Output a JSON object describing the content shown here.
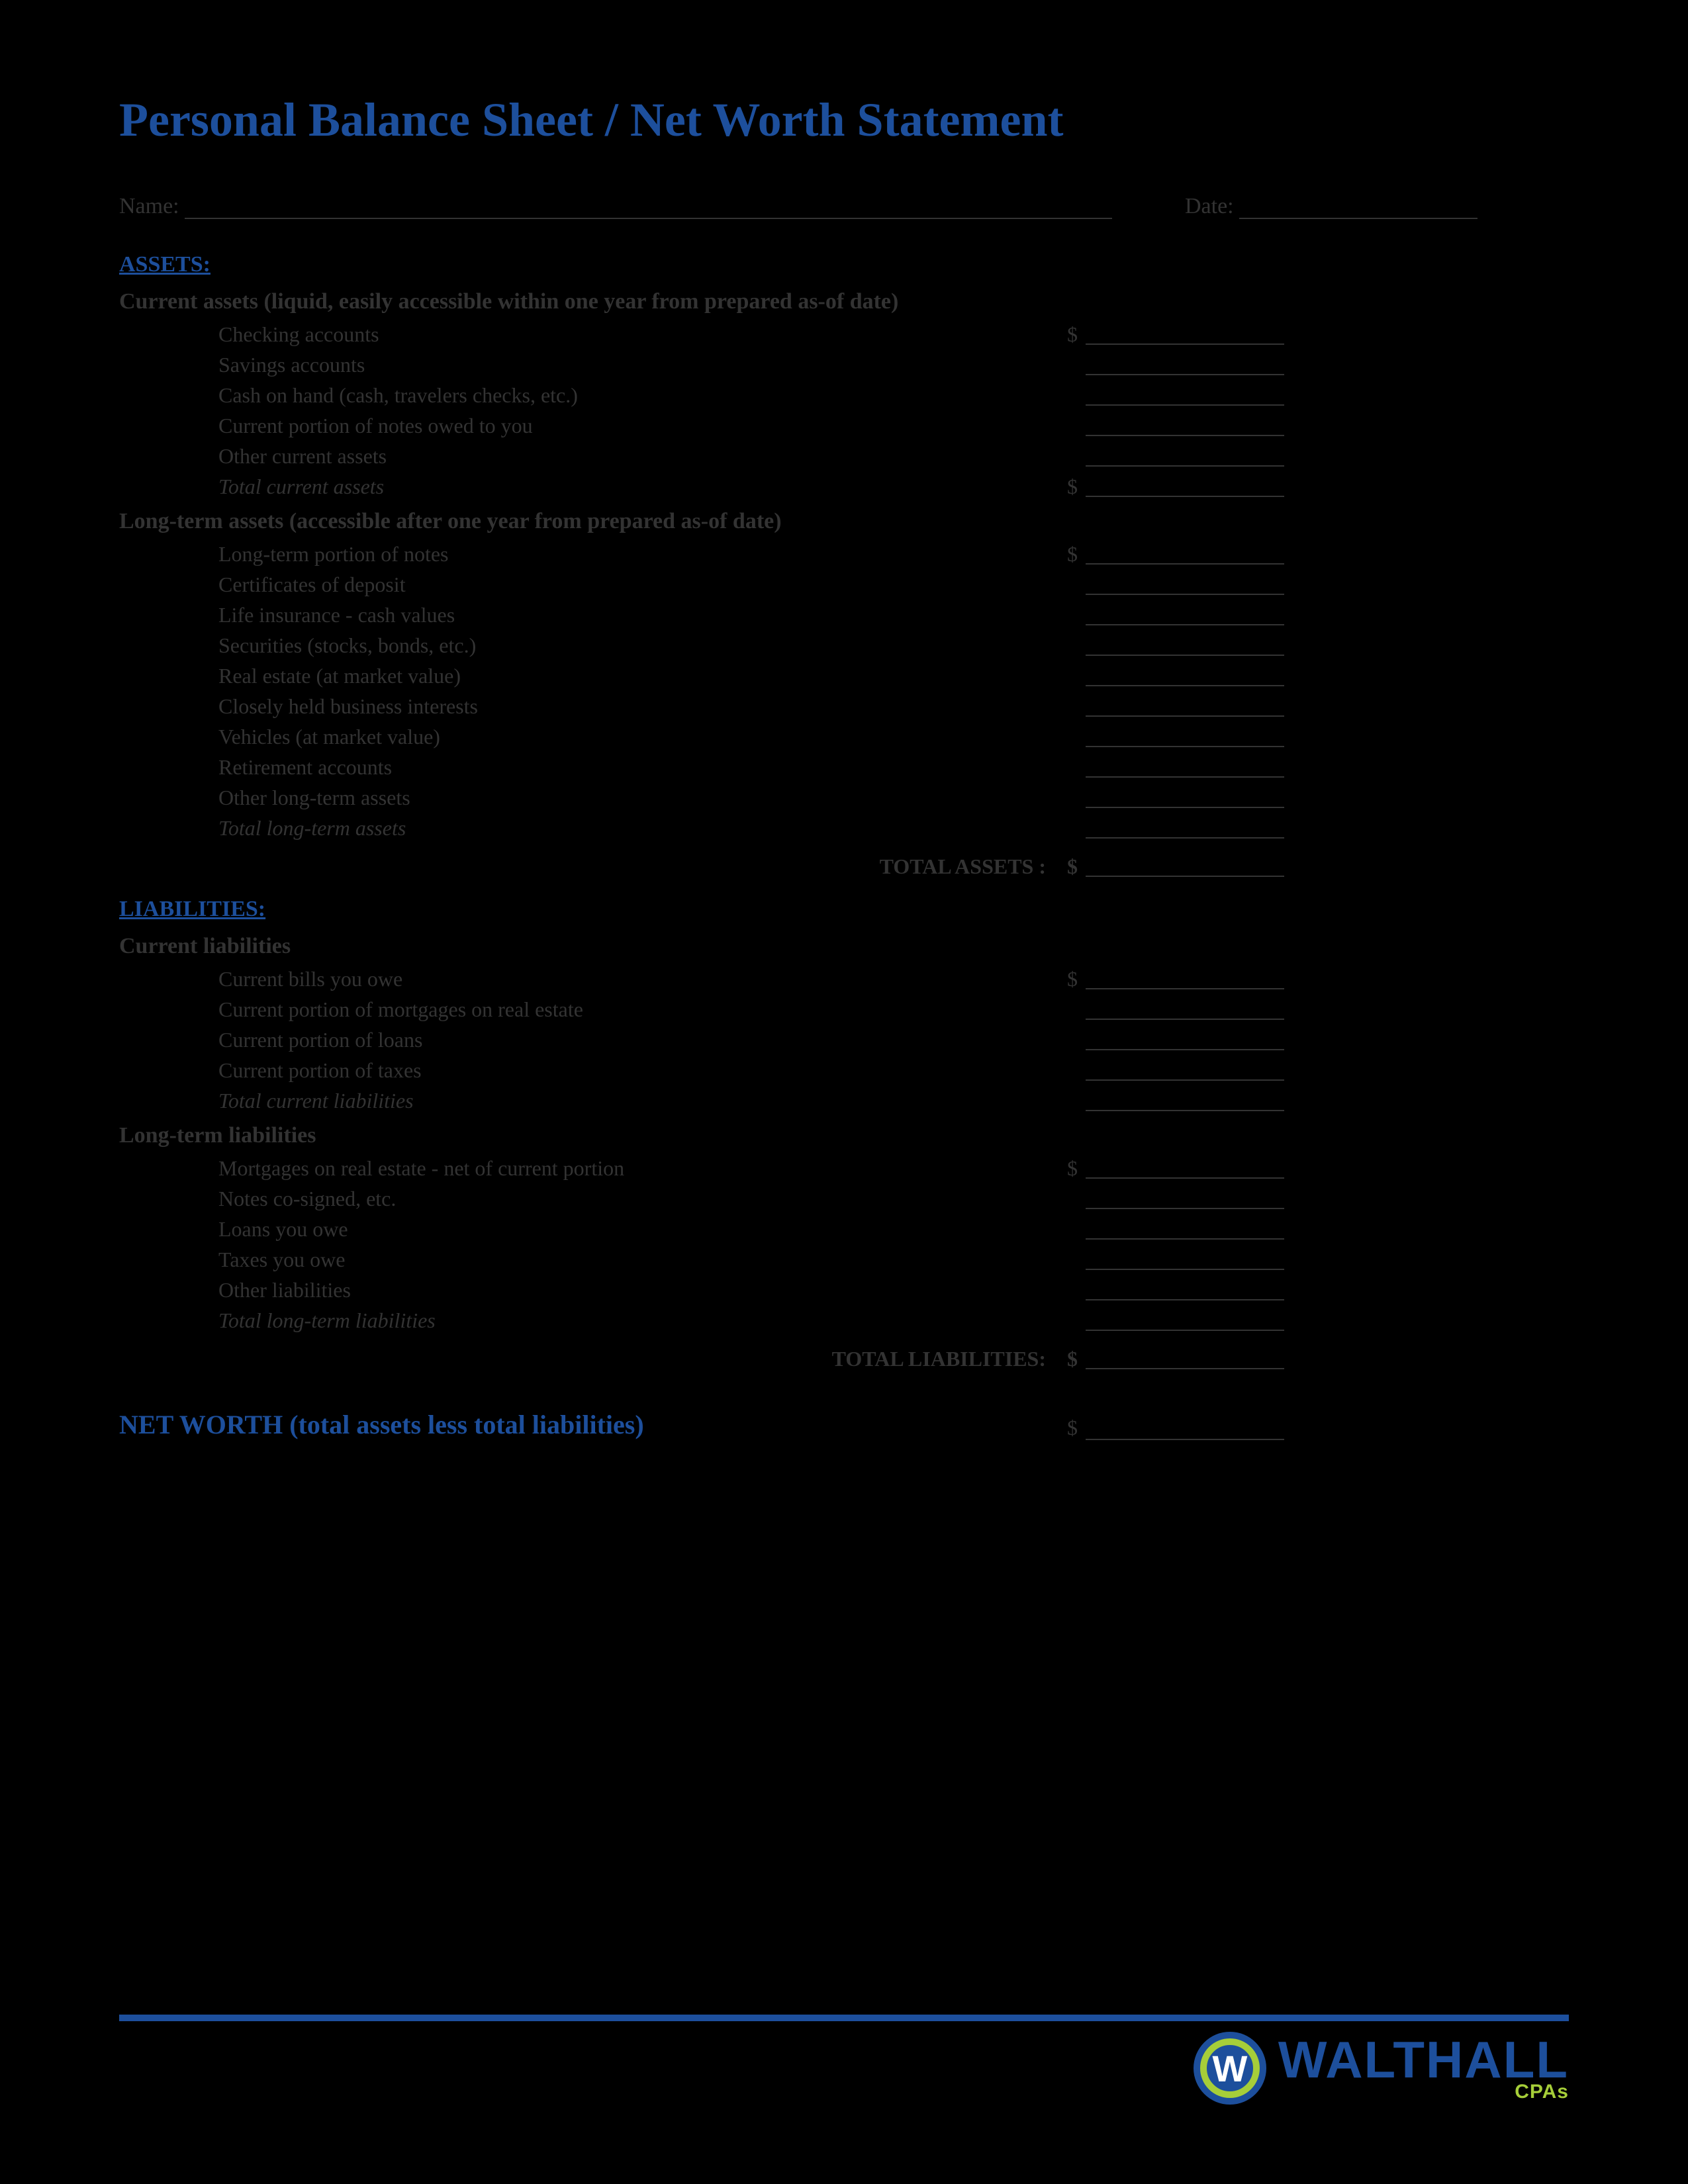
{
  "title": "Personal Balance Sheet / Net Worth Statement",
  "header": {
    "name_label": "Name:",
    "date_label": "Date:"
  },
  "assets": {
    "heading": "ASSETS:",
    "current": {
      "subhead": "Current assets (liquid, easily accessible within one year from prepared as-of date)",
      "items": [
        "Checking accounts",
        "Savings accounts",
        "Cash on hand (cash, travelers checks, etc.)",
        "Current portion of notes owed to you",
        "Other current assets"
      ],
      "total_label": "Total current assets"
    },
    "longterm": {
      "subhead": "Long-term assets (accessible after one year from prepared as-of date)",
      "items": [
        "Long-term portion of notes",
        "Certificates of deposit",
        "Life insurance - cash values",
        "Securities (stocks, bonds, etc.)",
        "Real estate (at market value)",
        "Closely held business interests",
        "Vehicles (at market value)",
        "Retirement accounts",
        "Other long-term assets"
      ],
      "total_label": "Total long-term assets"
    },
    "grand_label": "TOTAL ASSETS :"
  },
  "liabilities": {
    "heading": "LIABILITIES:",
    "current": {
      "subhead": "Current liabilities",
      "items": [
        "Current bills you owe",
        "Current portion of mortgages on real estate",
        "Current portion of loans",
        "Current portion of taxes"
      ],
      "total_label": "Total current liabilities"
    },
    "longterm": {
      "subhead": "Long-term liabilities",
      "items": [
        "Mortgages on real estate - net of current portion",
        "Notes co-signed, etc.",
        "Loans you owe",
        "Taxes you owe",
        "Other liabilities"
      ],
      "total_label": "Total long-term liabilities"
    },
    "grand_label": "TOTAL LIABILITIES:"
  },
  "networth_label": "NET WORTH (total assets less total liabilities)",
  "currency": "$",
  "logo": {
    "name": "WALTHALL",
    "sub": "CPAs",
    "initial": "W"
  }
}
